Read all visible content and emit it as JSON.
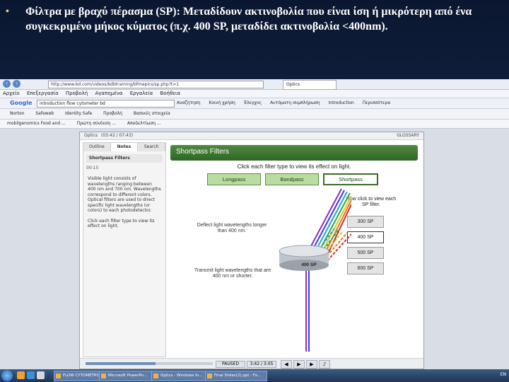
{
  "slide": {
    "bullet": "•",
    "text": "Φίλτρα με βραχύ πέρασμα (SP): Μεταδίδουν ακτινοβολία που είναι ίση ή μικρότερη από ένα συγκεκριμένο μήκος κύματος (π.χ. 400 SP, μεταδίδει ακτινοβολία <400nm)."
  },
  "browser": {
    "url": "http://www.bd.com/videos/bdbtraining/bfmepics/sp.php?t=1",
    "tab_label": "Optics",
    "menu": [
      "Αρχείο",
      "Επεξεργασία",
      "Προβολή",
      "Αγαπημένα",
      "Εργαλεία",
      "Βοήθεια"
    ],
    "google_search_value": "introduction flow cytometer bd",
    "google_items": [
      "Αναζήτηση",
      "Κοινή χρήση",
      "Έλεγχος",
      "Αυτόματη συμπλήρωση",
      "Introduction",
      "Περισσότερα"
    ],
    "norton_items": [
      "Norton",
      "Safeweb",
      "Identity Safe",
      "Προβολή",
      "Βασικές στοιχεία"
    ],
    "fav_items": [
      "mobilgenomics Food and ...",
      "Πρώτη σύνδεση ...",
      "Αποδελτίωση ..."
    ]
  },
  "player": {
    "title": "Optics",
    "time_label": "(03:42 / 07:43)",
    "glossary": "GLOSSARY",
    "tabs": [
      "Outline",
      "Notes",
      "Search"
    ],
    "section_title": "Shortpass Filters",
    "section_time": "00:15",
    "notes_p1": "Visible light consists of wavelengths ranging between 400 nm and 700 nm. Wavelengths correspond to different colors. Optical filters are used to direct specific light wavelengths (or colors) to each photodetector.",
    "notes_p2": "Click each filter type to view its effect on light.",
    "paused": "PAUSED",
    "elapsed": "3:42 / 3:05",
    "progress_pct": 55
  },
  "content": {
    "banner": "Shortpass Filters",
    "instruction": "Click each filter type to view its effect on light.",
    "filter_buttons": [
      "Longpass",
      "Bandpass",
      "Shortpass"
    ],
    "selected_filter": "Shortpass",
    "now_click": "Now click to view each SP filter.",
    "sp_buttons": [
      "300 SP",
      "400 SP",
      "500 SP",
      "600 SP"
    ],
    "selected_sp": "400 SP",
    "deflect_text": "Deflect light wavelengths longer than 400 nm.",
    "transmit_text": "Transmit light wavelengths that are 400 nm or shorter.",
    "filter_label": "400 SP"
  },
  "taskbar": {
    "tasks": [
      "FLOW CYTOMETRY...",
      "Microsoft PowerPo...",
      "Optics - Windows In...",
      "Final Slides(2).ppt - Fo..."
    ],
    "tray": "EN"
  },
  "colors": {
    "banner": "#2f6527",
    "filter_btn": "#b8dca1",
    "slide_bg": "#0b1730"
  }
}
